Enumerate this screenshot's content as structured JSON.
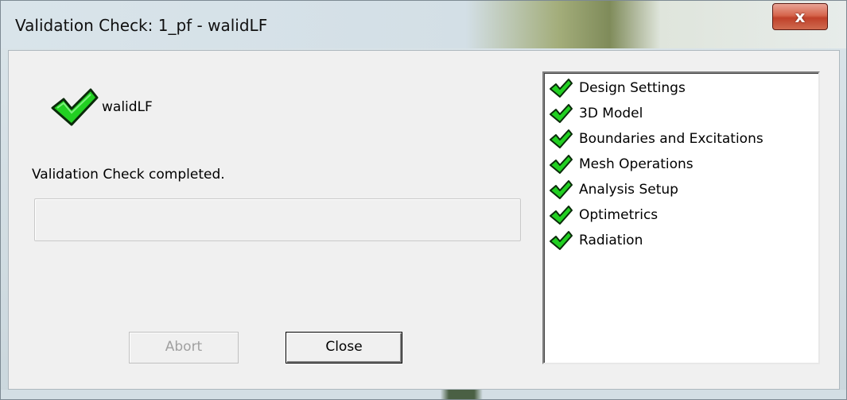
{
  "window": {
    "title": "Validation Check: 1_pf - walidLF",
    "close_glyph": "x"
  },
  "main": {
    "design_name": "walidLF",
    "status_text": "Validation Check completed.",
    "progress_value": 0
  },
  "buttons": {
    "abort_label": "Abort",
    "abort_enabled": false,
    "close_label": "Close"
  },
  "checks": [
    {
      "label": "Design Settings",
      "status": "passed",
      "icon": "green-check-icon"
    },
    {
      "label": "3D Model",
      "status": "passed",
      "icon": "green-check-icon"
    },
    {
      "label": "Boundaries and Excitations",
      "status": "passed",
      "icon": "green-check-icon"
    },
    {
      "label": "Mesh Operations",
      "status": "passed",
      "icon": "green-check-icon"
    },
    {
      "label": "Analysis Setup",
      "status": "passed",
      "icon": "green-check-icon"
    },
    {
      "label": "Optimetrics",
      "status": "passed",
      "icon": "green-check-icon"
    },
    {
      "label": "Radiation",
      "status": "passed",
      "icon": "green-check-icon"
    }
  ],
  "colors": {
    "check_green": "#22d022",
    "check_outline": "#0a2a0a",
    "close_button_red": "#c8452c"
  }
}
